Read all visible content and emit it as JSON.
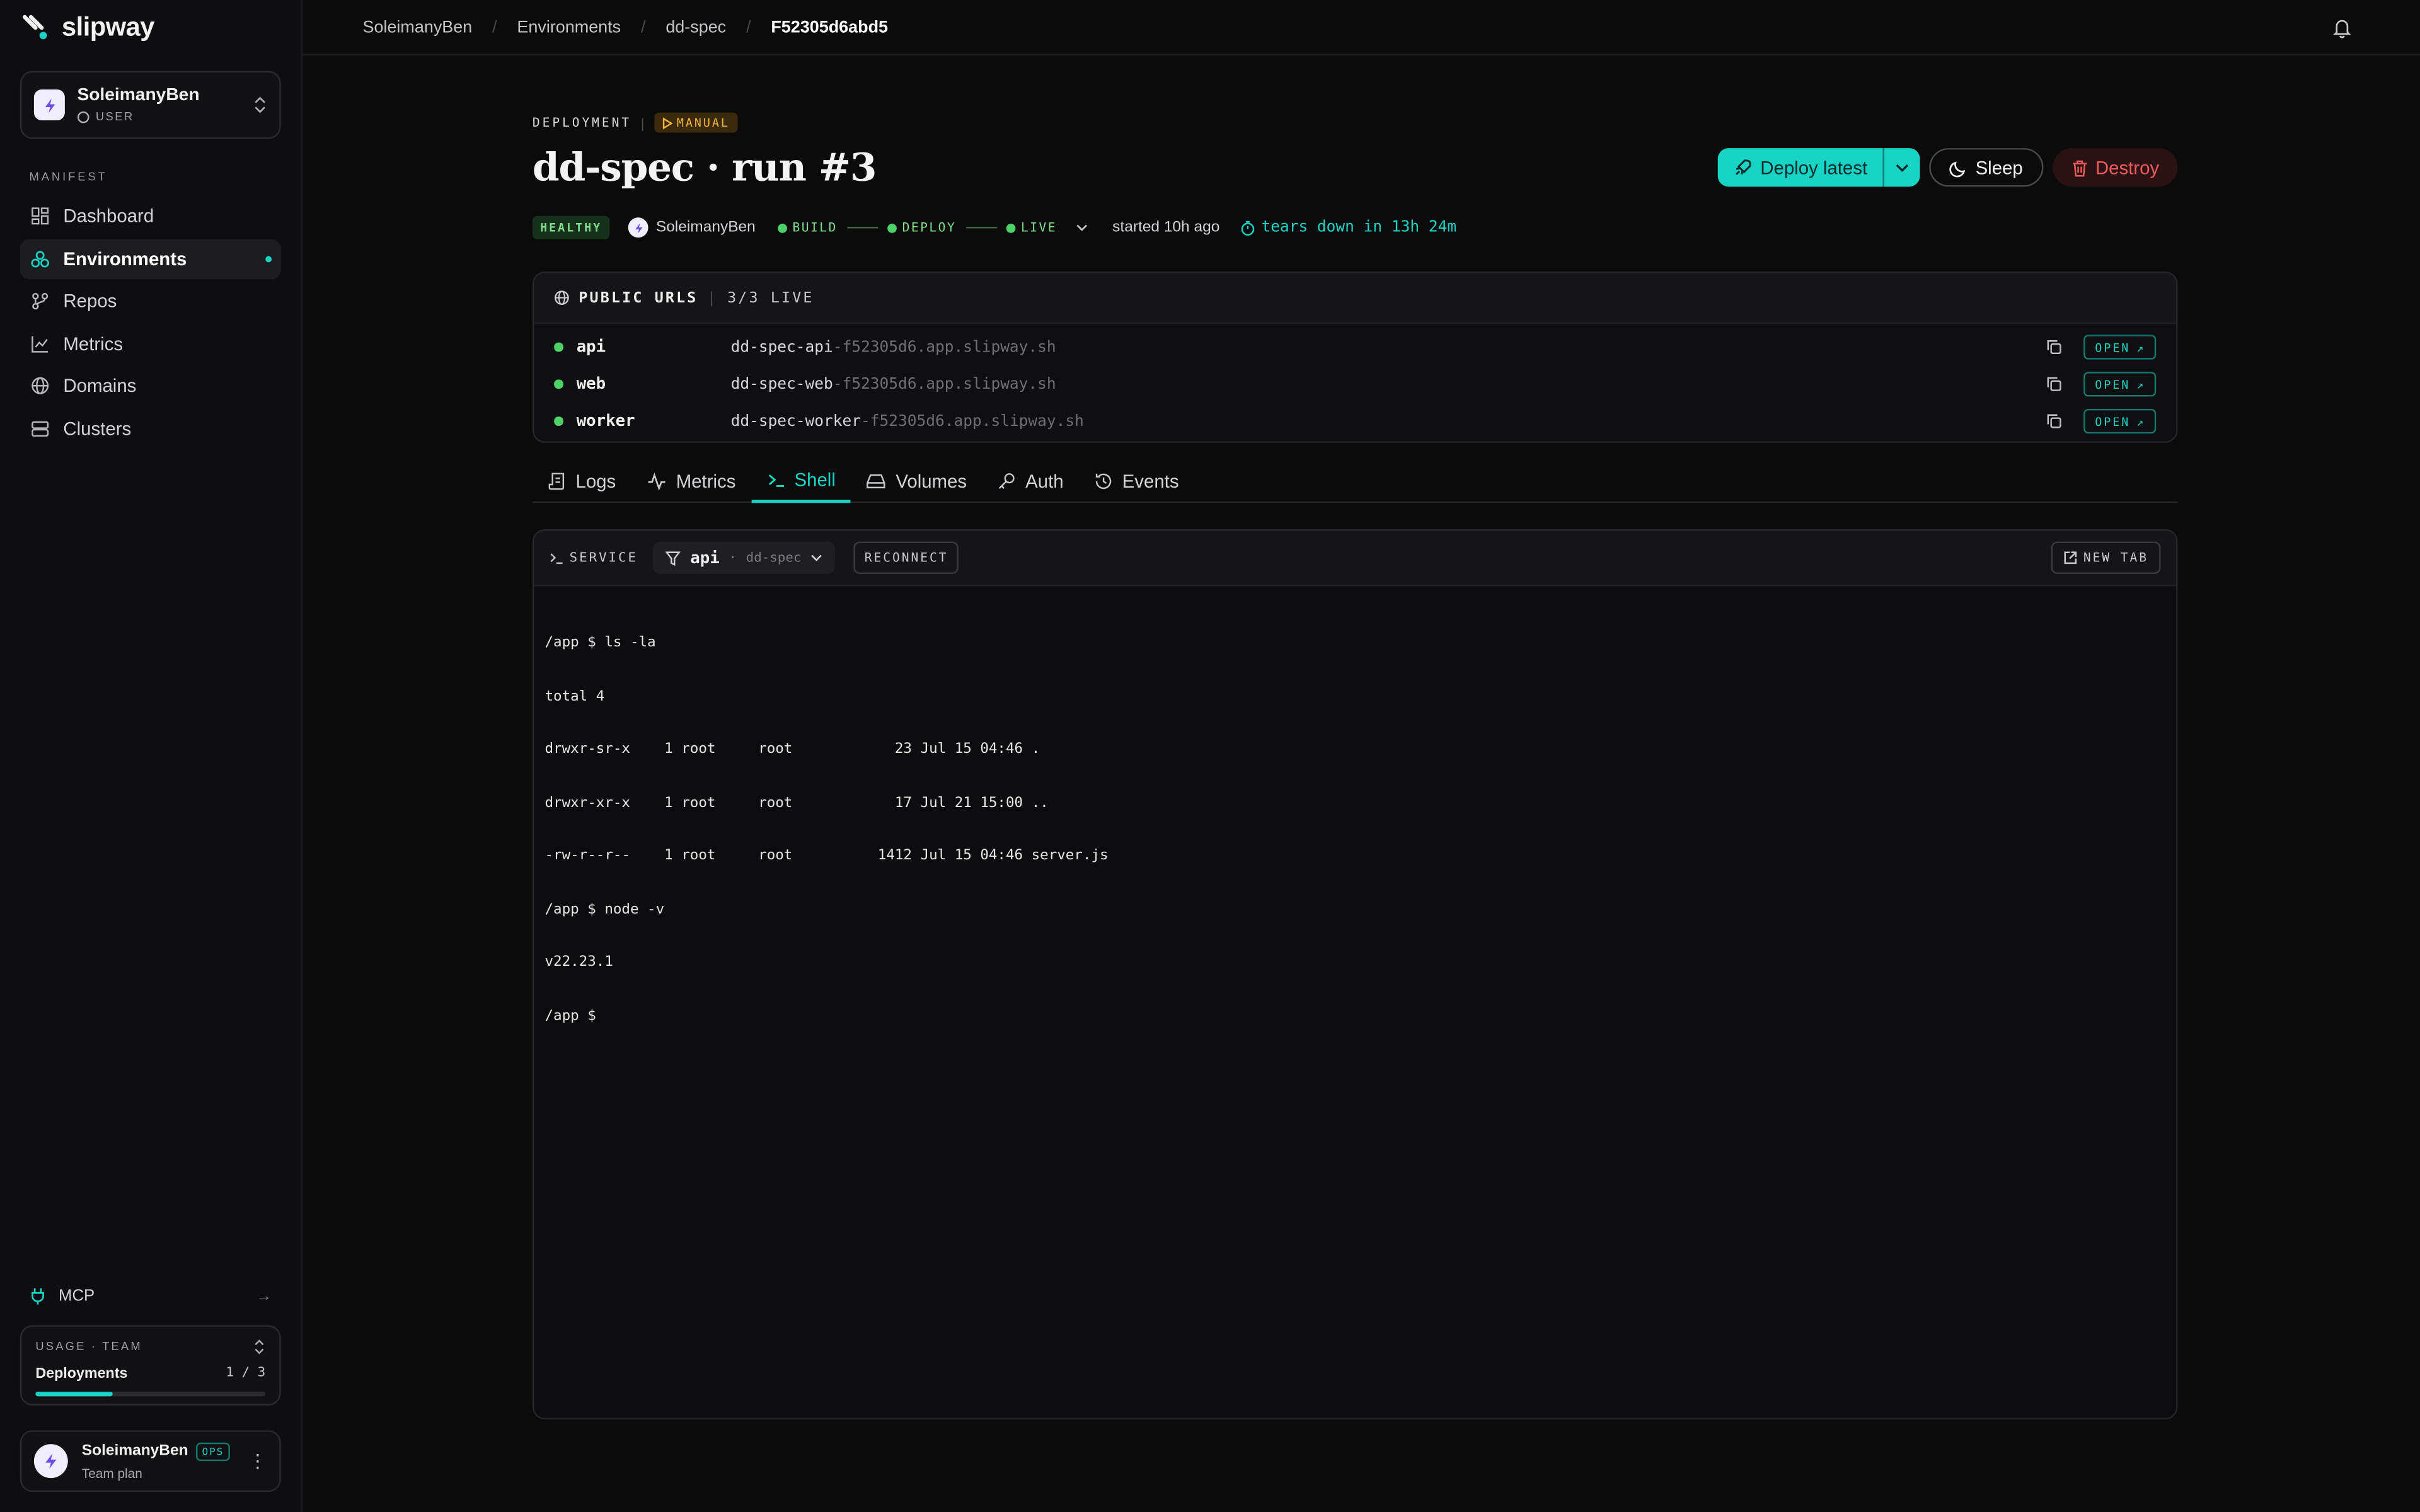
{
  "brand": {
    "name": "slipway"
  },
  "account": {
    "name": "SoleimanyBen",
    "role": "USER"
  },
  "sidebar": {
    "section": "MANIFEST",
    "items": [
      {
        "label": "Dashboard",
        "icon": "dashboard-icon"
      },
      {
        "label": "Environments",
        "icon": "environments-icon",
        "active": true
      },
      {
        "label": "Repos",
        "icon": "repo-icon"
      },
      {
        "label": "Metrics",
        "icon": "metrics-icon"
      },
      {
        "label": "Domains",
        "icon": "globe-icon"
      },
      {
        "label": "Clusters",
        "icon": "server-icon"
      }
    ],
    "mcp": "MCP",
    "usage": {
      "heading": "USAGE · TEAM",
      "label": "Deployments",
      "count": "1 / 3",
      "fraction": 0.3333
    },
    "user": {
      "name": "SoleimanyBen",
      "badge": "OPS",
      "plan": "Team plan"
    }
  },
  "breadcrumb": [
    "SoleimanyBen",
    "Environments",
    "dd-spec",
    "F52305d6abd5"
  ],
  "deployment": {
    "label": "DEPLOYMENT",
    "trigger": "MANUAL",
    "title": "dd-spec · run #3",
    "actions": {
      "deploy": "Deploy latest",
      "sleep": "Sleep",
      "destroy": "Destroy"
    },
    "status": "HEALTHY",
    "owner": "SoleimanyBen",
    "stages": [
      "BUILD",
      "DEPLOY",
      "LIVE"
    ],
    "started": "started 10h ago",
    "teardown": "tears down in 13h 24m"
  },
  "public_urls": {
    "title": "PUBLIC URLS",
    "count": "3/3 LIVE",
    "open_label": "OPEN",
    "rows": [
      {
        "name": "api",
        "host": "dd-spec-api",
        "suffix": "-f52305d6.app.slipway.sh"
      },
      {
        "name": "web",
        "host": "dd-spec-web",
        "suffix": "-f52305d6.app.slipway.sh"
      },
      {
        "name": "worker",
        "host": "dd-spec-worker",
        "suffix": "-f52305d6.app.slipway.sh"
      }
    ]
  },
  "tabs": [
    {
      "label": "Logs",
      "icon": "logs-icon"
    },
    {
      "label": "Metrics",
      "icon": "activity-icon"
    },
    {
      "label": "Shell",
      "icon": "terminal-icon",
      "active": true
    },
    {
      "label": "Volumes",
      "icon": "disk-icon"
    },
    {
      "label": "Auth",
      "icon": "key-icon"
    },
    {
      "label": "Events",
      "icon": "history-icon"
    }
  ],
  "shell": {
    "service_label": "SERVICE",
    "service": "api",
    "env": "dd-spec",
    "reconnect": "RECONNECT",
    "new_tab": "NEW TAB",
    "lines": [
      "/app $ ls -la",
      "total 4",
      "drwxr-sr-x    1 root     root            23 Jul 15 04:46 .",
      "drwxr-xr-x    1 root     root            17 Jul 21 15:00 ..",
      "-rw-r--r--    1 root     root          1412 Jul 15 04:46 server.js",
      "/app $ node -v",
      "v22.23.1",
      "/app $ "
    ]
  },
  "colors": {
    "accent": "#19d3c5",
    "live": "#4fd16a",
    "danger": "#ef5a5a",
    "warning": "#f0b53a"
  }
}
